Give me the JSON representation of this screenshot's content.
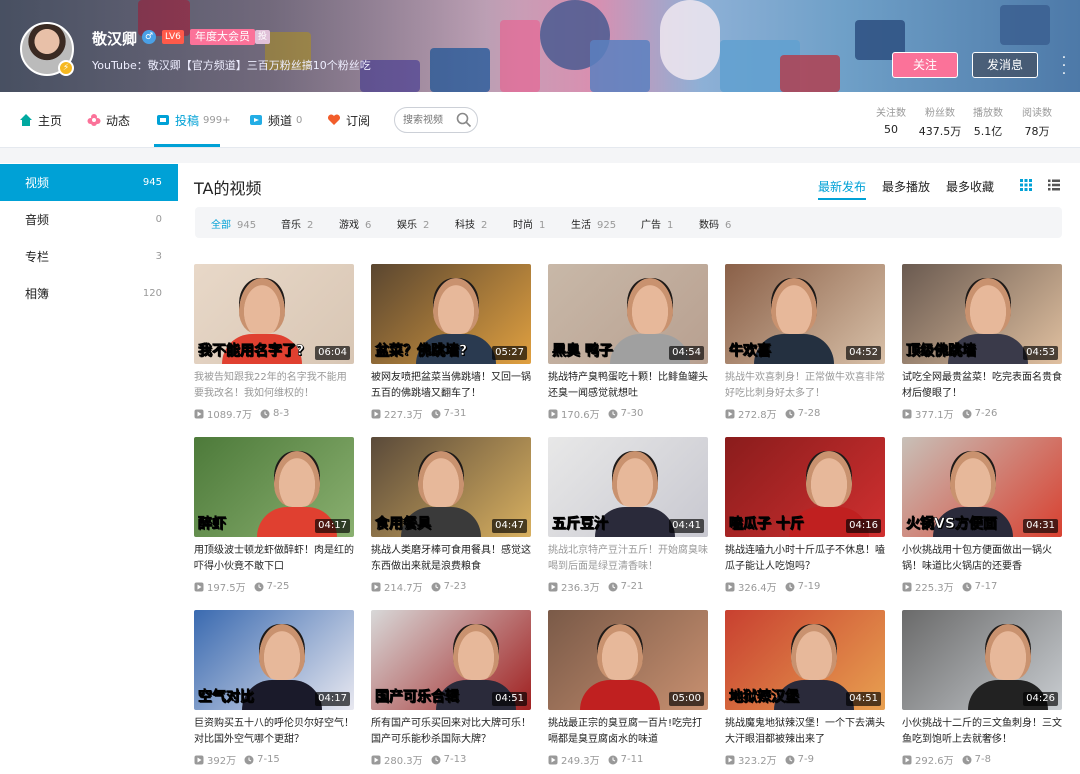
{
  "header": {
    "username": "敬汉卿",
    "gender_icon": "♂",
    "level": "LV6",
    "vip_label": "年度大会员",
    "vip_mark": "投",
    "badge_icon": "⚡",
    "sign": "YouTube：敬汉卿【官方频道】三百万粉丝搞10个粉丝吃",
    "follow_label": "关注",
    "message_label": "发消息"
  },
  "nav": {
    "items": [
      {
        "label": "主页",
        "count": ""
      },
      {
        "label": "动态",
        "count": ""
      },
      {
        "label": "投稿",
        "count": "999+"
      },
      {
        "label": "频道",
        "count": "0"
      },
      {
        "label": "订阅",
        "count": ""
      }
    ],
    "search_placeholder": "搜索视频",
    "stats": [
      {
        "label": "关注数",
        "value": "50"
      },
      {
        "label": "粉丝数",
        "value": "437.5万"
      },
      {
        "label": "播放数",
        "value": "5.1亿"
      },
      {
        "label": "阅读数",
        "value": "78万"
      }
    ]
  },
  "sidebar": {
    "items": [
      {
        "label": "视频",
        "count": "945"
      },
      {
        "label": "音频",
        "count": "0"
      },
      {
        "label": "专栏",
        "count": "3"
      },
      {
        "label": "相簿",
        "count": "120"
      }
    ]
  },
  "main": {
    "title": "TA的视频",
    "sort": [
      "最新发布",
      "最多播放",
      "最多收藏"
    ],
    "filters": [
      {
        "label": "全部",
        "count": "945"
      },
      {
        "label": "音乐",
        "count": "2"
      },
      {
        "label": "游戏",
        "count": "6"
      },
      {
        "label": "娱乐",
        "count": "2"
      },
      {
        "label": "科技",
        "count": "2"
      },
      {
        "label": "时尚",
        "count": "1"
      },
      {
        "label": "生活",
        "count": "925"
      },
      {
        "label": "广告",
        "count": "1"
      },
      {
        "label": "数码",
        "count": "6"
      }
    ]
  },
  "videos": [
    {
      "caption": "我不能用名字了?",
      "duration": "06:04",
      "title": "我被告知跟我22年的名字我不能用要我改名！我如何维权的！",
      "plays": "1089.7万",
      "date": "8-3"
    },
    {
      "caption": "盆菜？佛跳墙?",
      "duration": "05:27",
      "title": "被网友喷把盆菜当佛跳墙！又回一锅五百的佛跳墙又翻车了！",
      "plays": "227.3万",
      "date": "7-31"
    },
    {
      "caption": "黑臭 鸭子",
      "duration": "04:54",
      "title": "挑战特产臭鸭蛋吃十颗！比鲱鱼罐头还臭一闻感觉就想吐",
      "plays": "170.6万",
      "date": "7-30"
    },
    {
      "caption": "牛欢喜",
      "duration": "04:52",
      "title": "挑战牛欢喜刺身！正常做牛欢喜非常好吃比刺身好太多了！",
      "plays": "272.8万",
      "date": "7-28"
    },
    {
      "caption": "顶级佛跳墙",
      "duration": "04:53",
      "title": "试吃全网最贵盆菜！吃完表面名贵食材后傻眼了！",
      "plays": "377.1万",
      "date": "7-26"
    },
    {
      "caption": "醉虾",
      "duration": "04:17",
      "title": "用顶级波士顿龙虾做醉虾！肉是红的吓得小伙竟不敢下口",
      "plays": "197.5万",
      "date": "7-25"
    },
    {
      "caption": "食用餐具",
      "duration": "04:47",
      "title": "挑战人类磨牙棒可食用餐具！感觉这东西做出来就是浪费粮食",
      "plays": "214.7万",
      "date": "7-23"
    },
    {
      "caption": "五斤豆汁",
      "duration": "04:41",
      "title": "挑战北京特产豆汁五斤！开始腐臭味喝到后面是绿豆清香味！",
      "plays": "236.3万",
      "date": "7-21"
    },
    {
      "caption": "嗑瓜子 十斤",
      "duration": "04:16",
      "title": "挑战连嗑九小时十斤瓜子不休息！嗑瓜子能让人吃饱吗？",
      "plays": "326.4万",
      "date": "7-19"
    },
    {
      "caption": "火锅VS方便面",
      "duration": "04:31",
      "title": "小伙挑战用十包方便面做出一锅火锅！味道比火锅店的还要香",
      "plays": "225.3万",
      "date": "7-17"
    },
    {
      "caption": "空气对比",
      "duration": "04:17",
      "title": "巨资购买五十八的呼伦贝尔好空气！对比国外空气哪个更甜？",
      "plays": "392万",
      "date": "7-15"
    },
    {
      "caption": "国产可乐合辑",
      "duration": "04:51",
      "title": "所有国产可乐买回来对比大牌可乐！国产可乐能秒杀国际大牌？",
      "plays": "280.3万",
      "date": "7-13"
    },
    {
      "caption": "",
      "duration": "05:00",
      "title": "挑战最正宗的臭豆腐一百片!吃完打嗝都是臭豆腐卤水的味道",
      "plays": "249.3万",
      "date": "7-11"
    },
    {
      "caption": "地狱辣汉堡",
      "duration": "04:51",
      "title": "挑战魔鬼地狱辣汉堡！一个下去满头大汗眼泪都被辣出来了",
      "plays": "323.2万",
      "date": "7-9"
    },
    {
      "caption": "",
      "duration": "04:26",
      "title": "小伙挑战十二斤的三文鱼刺身！三文鱼吃到饱听上去就奢侈！",
      "plays": "292.6万",
      "date": "7-8"
    }
  ]
}
